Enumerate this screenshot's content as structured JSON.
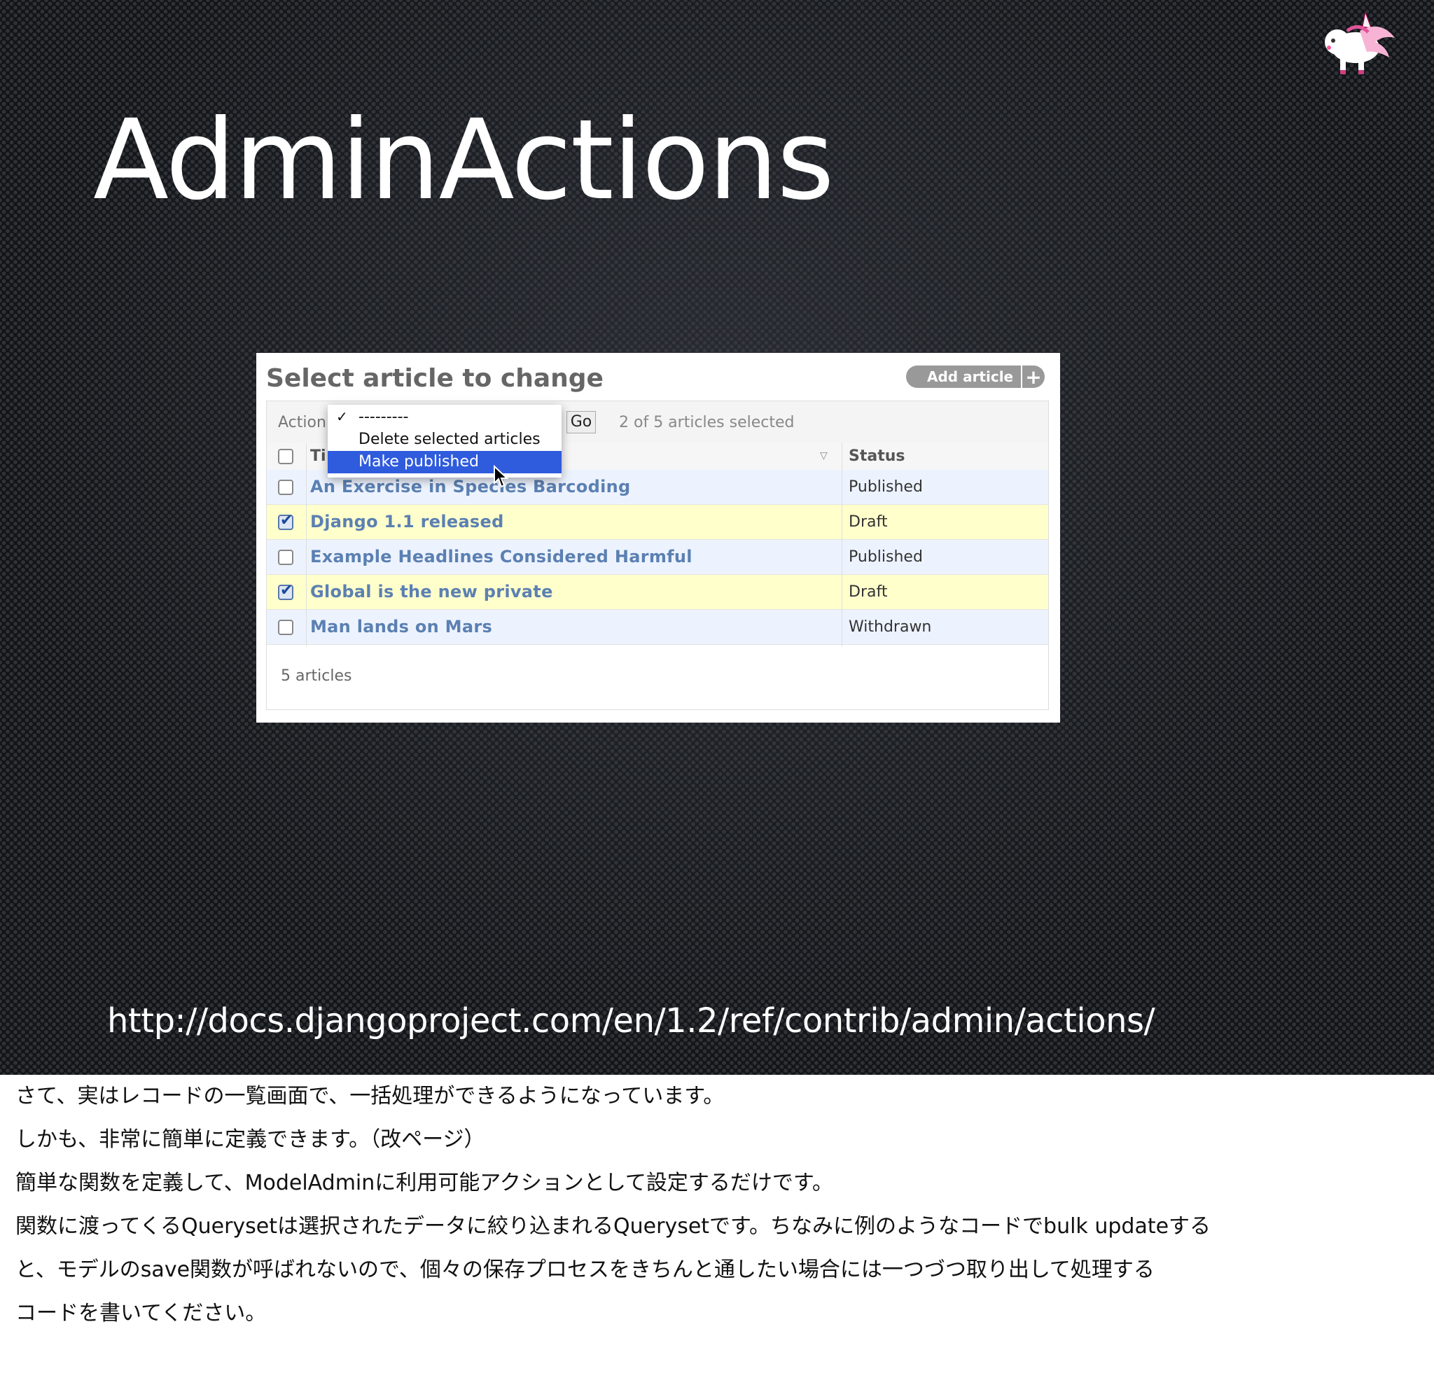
{
  "slide": {
    "title": "AdminActions",
    "url": "http://docs.djangoproject.com/en/1.2/ref/contrib/admin/actions/"
  },
  "admin": {
    "heading": "Select article to change",
    "add_button": "Add article",
    "add_icon": "+",
    "action_label": "Action:",
    "go_button": "Go",
    "selection_count": "2 of 5 articles selected",
    "columns": {
      "title": "Ti",
      "status": "Status"
    },
    "dropdown": {
      "options": [
        {
          "check": "✓",
          "label": "---------"
        },
        {
          "check": "",
          "label": "Delete selected articles"
        },
        {
          "check": "",
          "label": "Make published"
        }
      ],
      "highlight_color": "#2f5bdd"
    },
    "rows": [
      {
        "title": "An Exercise in Species Barcoding",
        "status": "Published",
        "checked": false
      },
      {
        "title": "Django 1.1 released",
        "status": "Draft",
        "checked": true
      },
      {
        "title": "Example Headlines Considered Harmful",
        "status": "Published",
        "checked": false
      },
      {
        "title": "Global is the new private",
        "status": "Draft",
        "checked": true
      },
      {
        "title": "Man lands on Mars",
        "status": "Withdrawn",
        "checked": false
      }
    ],
    "footer": "5 articles",
    "link_color": "#5b80b2",
    "selected_row_color": "#ffffcc"
  },
  "notes": [
    "さて、実はレコードの一覧画面で、一括処理ができるようになっています。",
    "しかも、非常に簡単に定義できます。（改ページ）",
    "簡単な関数を定義して、ModelAdminに利用可能アクションとして設定するだけです。",
    "関数に渡ってくるQuerysetは選択されたデータに絞り込まれるQuerysetです。ちなみに例のようなコードでbulk updateする",
    "と、モデルのsave関数が呼ばれないので、個々の保存プロセスをきちんと通したい場合には一つづつ取り出して処理する",
    "コードを書いてください。"
  ]
}
